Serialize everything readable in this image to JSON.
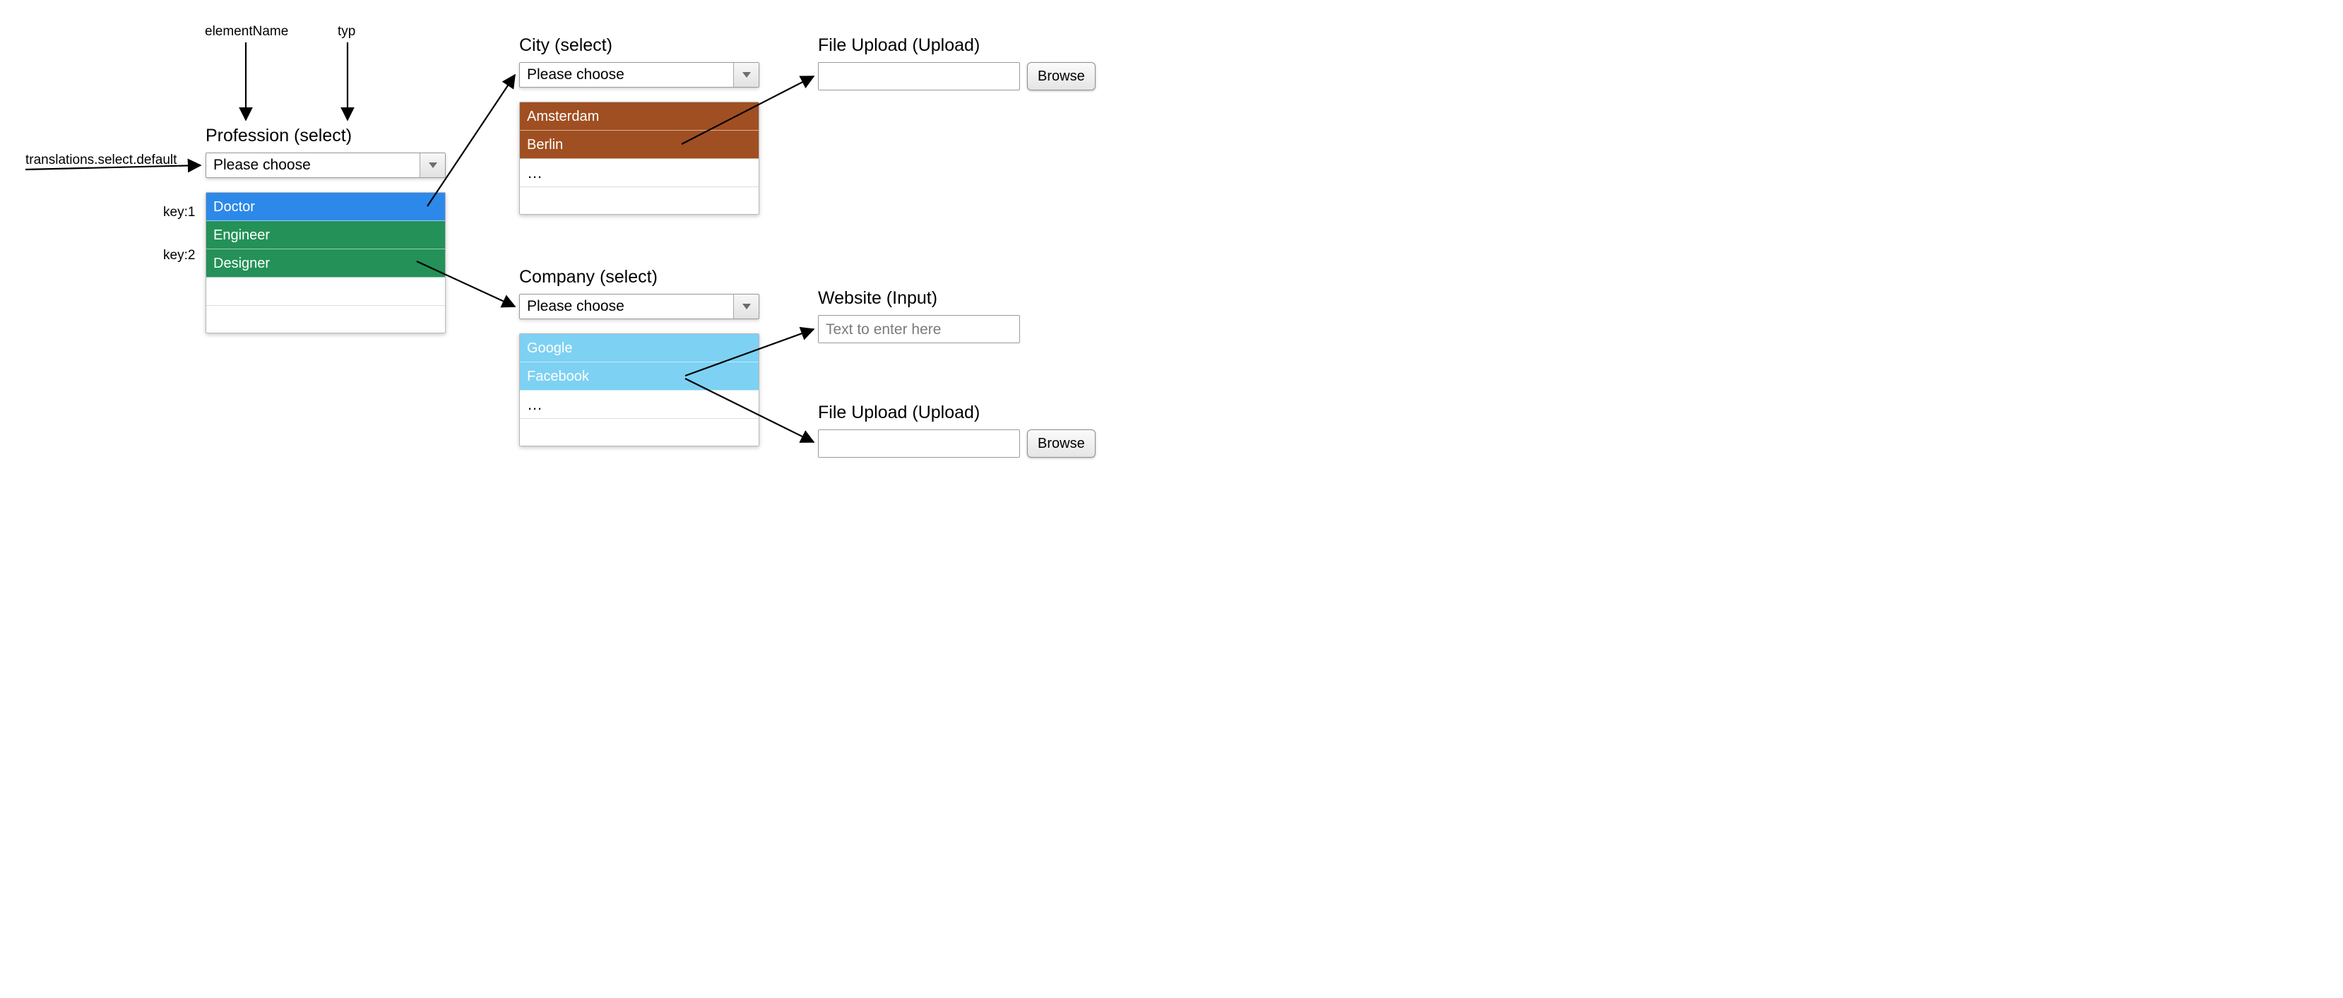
{
  "annotations": {
    "element_name_label": "elementName",
    "typ_label": "typ",
    "translations_default_label": "translations.select.default",
    "key1_label": "key:1",
    "key2_label": "key:2"
  },
  "profession": {
    "title": "Profession (select)",
    "placeholder": "Please choose",
    "options": [
      {
        "label": "Doctor",
        "color": "blue"
      },
      {
        "label": "Engineer",
        "color": "green"
      },
      {
        "label": "Designer",
        "color": "green"
      }
    ]
  },
  "city": {
    "title": "City (select)",
    "placeholder": "Please choose",
    "options": [
      {
        "label": "Amsterdam",
        "color": "brown"
      },
      {
        "label": "Berlin",
        "color": "brown"
      }
    ],
    "ellipsis": "…"
  },
  "company": {
    "title": "Company (select)",
    "placeholder": "Please choose",
    "options": [
      {
        "label": "Google",
        "color": "cyan"
      },
      {
        "label": "Facebook",
        "color": "cyan"
      }
    ],
    "ellipsis": "…"
  },
  "file_upload_top": {
    "title": "File Upload (Upload)",
    "button": "Browse"
  },
  "website_input": {
    "title": "Website (Input)",
    "placeholder": "Text to enter here"
  },
  "file_upload_bottom": {
    "title": "File Upload (Upload)",
    "button": "Browse"
  }
}
